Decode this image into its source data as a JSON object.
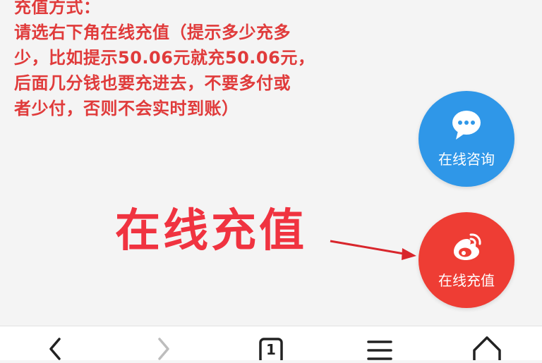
{
  "notice": {
    "lines": [
      "充值方式：",
      "请选右下角在线充值（提示多少充多",
      "少，比如提示50.06元就充50.06元，",
      "后面几分钱也要充进去，不要多付或",
      "者少付，否则不会实时到账）"
    ],
    "color": "#e03b3b"
  },
  "annotation": {
    "text": "在线充值",
    "color": "#f03340"
  },
  "fab_consult": {
    "label": "在线咨询",
    "icon": "chat-bubble-icon",
    "color": "#2f97e8"
  },
  "fab_recharge": {
    "label": "在线充值",
    "icon": "weibo-icon",
    "color": "#ee3d34"
  },
  "bottom_nav": {
    "tab_count": "1",
    "icons": [
      "back-icon",
      "forward-icon",
      "tabs-icon",
      "menu-icon",
      "home-icon"
    ]
  }
}
